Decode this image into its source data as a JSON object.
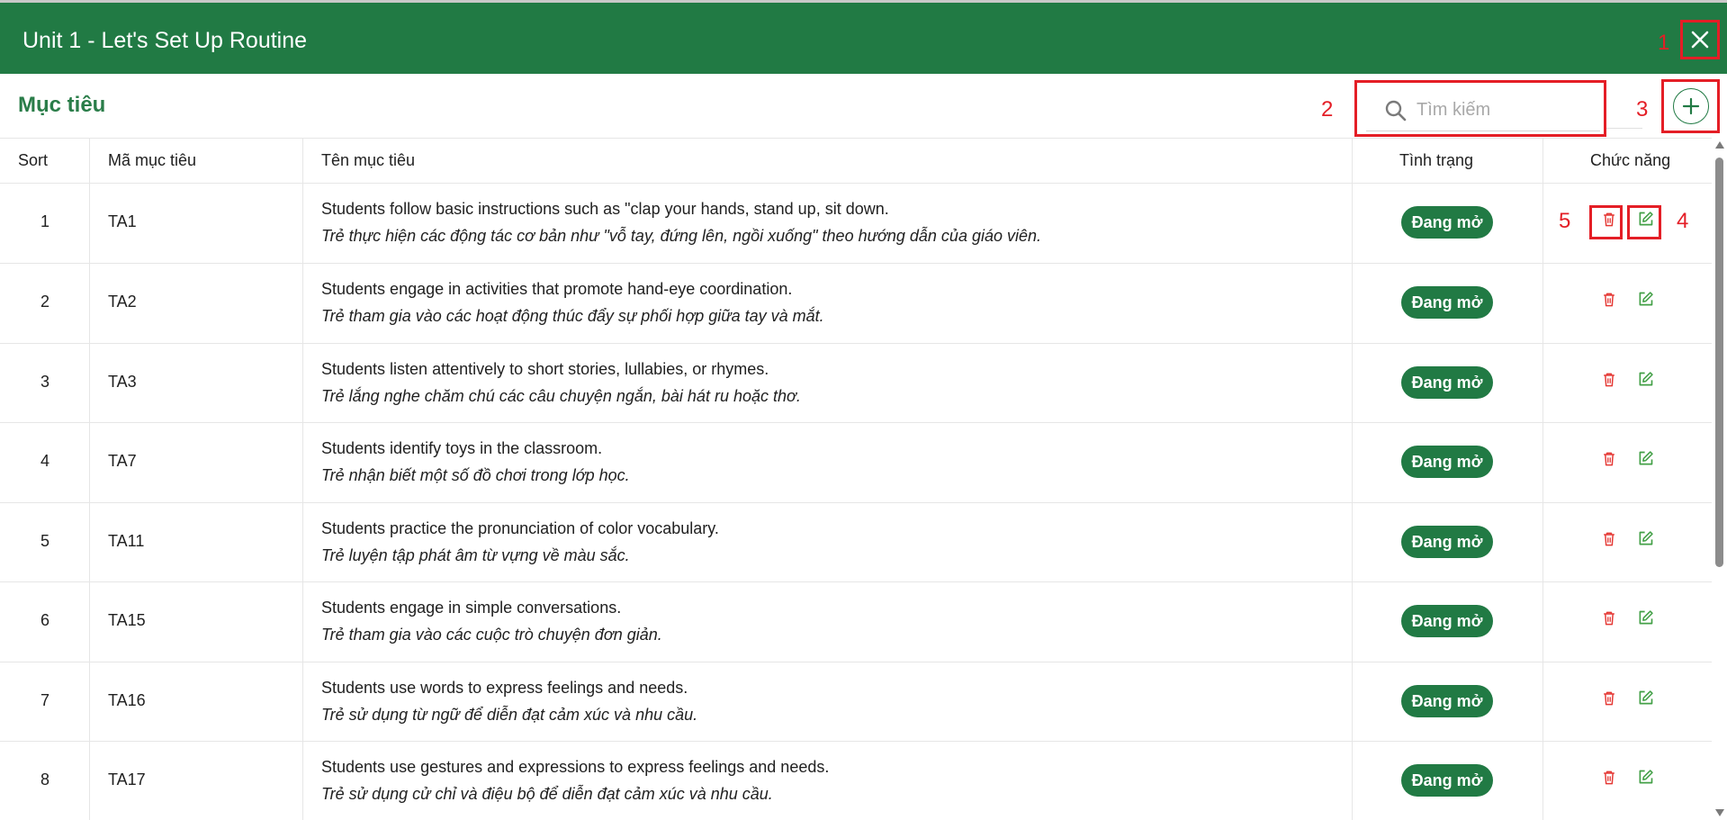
{
  "header": {
    "title": "Unit 1 - Let's Set Up Routine",
    "bg_color": "#217a44"
  },
  "annotations": {
    "close": "1",
    "search": "2",
    "add": "3",
    "edit": "4",
    "delete": "5"
  },
  "section": {
    "title": "Mục tiêu"
  },
  "search": {
    "placeholder": "Tìm kiếm",
    "value": ""
  },
  "table": {
    "columns": [
      "Sort",
      "Mã mục tiêu",
      "Tên mục tiêu",
      "Tình trạng",
      "Chức năng"
    ],
    "rows": [
      {
        "sort": "1",
        "code": "TA1",
        "en": "Students follow basic instructions such as \"clap your hands, stand up, sit down.",
        "vi": "Trẻ thực hiện các động tác cơ bản như \"vỗ tay, đứng lên, ngồi xuống\" theo hướng dẫn của giáo viên.",
        "status": "Đang mở"
      },
      {
        "sort": "2",
        "code": "TA2",
        "en": "Students engage in activities that promote hand-eye coordination.",
        "vi": "Trẻ tham gia vào các hoạt động thúc đẩy sự phối hợp giữa tay và mắt.",
        "status": "Đang mở"
      },
      {
        "sort": "3",
        "code": "TA3",
        "en": "Students listen attentively to short stories, lullabies, or rhymes.",
        "vi": "Trẻ lắng nghe chăm chú các câu chuyện ngắn, bài hát ru hoặc thơ.",
        "status": "Đang mở"
      },
      {
        "sort": "4",
        "code": "TA7",
        "en": "Students identify toys in the classroom.",
        "vi": "Trẻ nhận biết một số đồ chơi trong lớp học.",
        "status": "Đang mở"
      },
      {
        "sort": "5",
        "code": "TA11",
        "en": "Students practice the pronunciation of color vocabulary.",
        "vi": "Trẻ luyện tập phát âm từ vựng về màu sắc.",
        "status": "Đang mở"
      },
      {
        "sort": "6",
        "code": "TA15",
        "en": "Students engage in simple conversations.",
        "vi": "Trẻ tham gia vào các cuộc trò chuyện đơn giản.",
        "status": "Đang mở"
      },
      {
        "sort": "7",
        "code": "TA16",
        "en": "Students use words to express feelings and needs.",
        "vi": "Trẻ sử dụng từ ngữ để diễn đạt cảm xúc và nhu cầu.",
        "status": "Đang mở"
      },
      {
        "sort": "8",
        "code": "TA17",
        "en": "Students use gestures and expressions to express feelings and needs.",
        "vi": "Trẻ sử dụng cử chỉ và điệu bộ để diễn đạt cảm xúc và nhu cầu.",
        "status": "Đang mở"
      }
    ]
  },
  "icons": {
    "close": "close-icon",
    "search": "search-icon",
    "add": "plus-icon",
    "delete": "trash-icon",
    "edit": "edit-icon"
  },
  "colors": {
    "primary": "#217a44",
    "delete": "#e53935",
    "edit": "#43a047",
    "annotation": "#e41e26"
  }
}
